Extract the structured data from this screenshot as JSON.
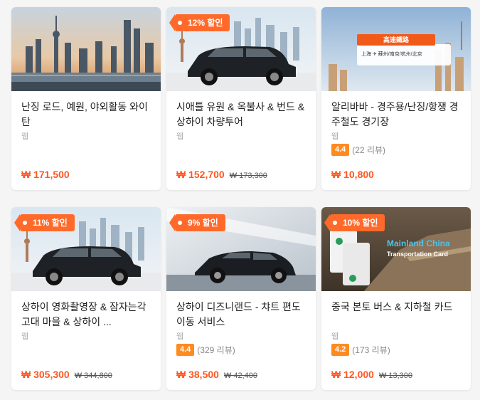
{
  "products": [
    {
      "title": "난징 로드, 예원, 야외활동 와이탄",
      "subtitle": "웹",
      "discount": "",
      "rating": "",
      "reviews": "",
      "price": "₩ 171,500",
      "old_price": ""
    },
    {
      "title": "시애틀 유원 & 옥불사 & 번드 & 상하이 차량투어",
      "subtitle": "웹",
      "discount": "12% 할인",
      "rating": "",
      "reviews": "",
      "price": "₩ 152,700",
      "old_price": "₩ 173,300"
    },
    {
      "title": "알리바바 - 경주용/난징/항쟁 경주철도 경기장",
      "subtitle": "웹",
      "discount": "",
      "rating": "4.4",
      "reviews": "(22 리뷰)",
      "price": "₩ 10,800",
      "old_price": "",
      "image_text": {
        "banner": "高速鐵路",
        "route": "上海 ✈ 蘇州/南京/杭州/北京"
      }
    },
    {
      "title": "상하이 영화촬영장 & 잠자는각 고대 마을 & 상하이 ...",
      "subtitle": "웹",
      "discount": "11% 할인",
      "rating": "",
      "reviews": "",
      "price": "₩ 305,300",
      "old_price": "₩ 344,800"
    },
    {
      "title": "상하이 디즈니랜드 - 챠트 편도 이동 서비스",
      "subtitle": "웹",
      "discount": "9% 할인",
      "rating": "4.4",
      "reviews": "(329 리뷰)",
      "price": "₩ 38,500",
      "old_price": "₩ 42,400"
    },
    {
      "title": "중국 본토 버스 & 지하철 카드",
      "subtitle": "웹",
      "discount": "10% 할인",
      "rating": "4.2",
      "reviews": "(173 리뷰)",
      "price": "₩ 12,000",
      "old_price": "₩ 13,300",
      "image_text": {
        "line1": "Mainland China",
        "line2": "Transportation Card"
      }
    }
  ],
  "colors": {
    "accent": "#ff5722",
    "badge": "#ff6a2b",
    "rating": "#ff8a1f",
    "card_blue": "#4ec3e8"
  }
}
